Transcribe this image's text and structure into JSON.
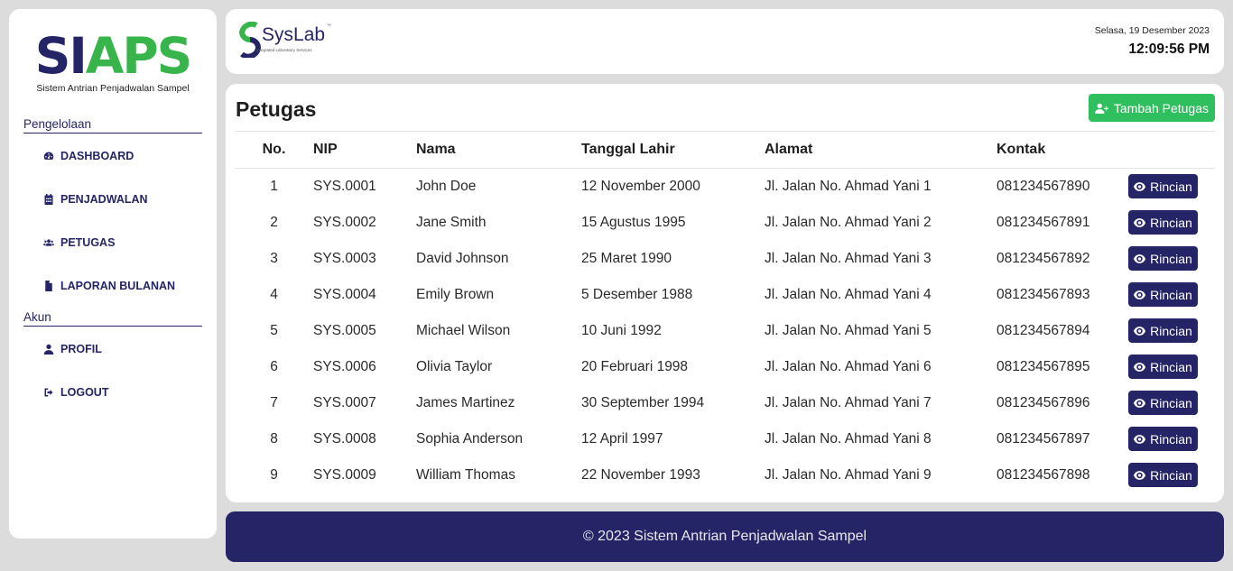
{
  "sidebar": {
    "logo_part1": "SI",
    "logo_part2": "APS",
    "logo_subtitle": "Sistem Antrian Penjadwalan Sampel",
    "sections": [
      {
        "title": "Pengelolaan"
      },
      {
        "title": "Akun"
      }
    ],
    "items": [
      {
        "label": "DASHBOARD",
        "icon": "gauge-icon"
      },
      {
        "label": "PENJADWALAN",
        "icon": "calendar-icon"
      },
      {
        "label": "PETUGAS",
        "icon": "users-icon"
      },
      {
        "label": "LAPORAN BULANAN",
        "icon": "file-icon"
      },
      {
        "label": "PROFIL",
        "icon": "user-icon"
      },
      {
        "label": "LOGOUT",
        "icon": "logout-icon"
      }
    ]
  },
  "header": {
    "brand_sys": "Sys",
    "brand_lab": "Lab",
    "brand_tm": "™",
    "brand_tagline": "Integrated Laboratory Services",
    "date": "Selasa, 19 Desember 2023",
    "time": "12:09:56 PM"
  },
  "main": {
    "title": "Petugas",
    "add_button": "Tambah Petugas",
    "columns": [
      "No.",
      "NIP",
      "Nama",
      "Tanggal Lahir",
      "Alamat",
      "Kontak"
    ],
    "action_label": "Rincian",
    "rows": [
      {
        "no": "1",
        "nip": "SYS.0001",
        "nama": "John Doe",
        "tgl": "12 November 2000",
        "alamat": "Jl. Jalan No. Ahmad Yani 1",
        "kontak": "081234567890"
      },
      {
        "no": "2",
        "nip": "SYS.0002",
        "nama": "Jane Smith",
        "tgl": "15 Agustus 1995",
        "alamat": "Jl. Jalan No. Ahmad Yani 2",
        "kontak": "081234567891"
      },
      {
        "no": "3",
        "nip": "SYS.0003",
        "nama": "David Johnson",
        "tgl": "25 Maret 1990",
        "alamat": "Jl. Jalan No. Ahmad Yani 3",
        "kontak": "081234567892"
      },
      {
        "no": "4",
        "nip": "SYS.0004",
        "nama": "Emily Brown",
        "tgl": "5 Desember 1988",
        "alamat": "Jl. Jalan No. Ahmad Yani 4",
        "kontak": "081234567893"
      },
      {
        "no": "5",
        "nip": "SYS.0005",
        "nama": "Michael Wilson",
        "tgl": "10 Juni 1992",
        "alamat": "Jl. Jalan No. Ahmad Yani 5",
        "kontak": "081234567894"
      },
      {
        "no": "6",
        "nip": "SYS.0006",
        "nama": "Olivia Taylor",
        "tgl": "20 Februari 1998",
        "alamat": "Jl. Jalan No. Ahmad Yani 6",
        "kontak": "081234567895"
      },
      {
        "no": "7",
        "nip": "SYS.0007",
        "nama": "James Martinez",
        "tgl": "30 September 1994",
        "alamat": "Jl. Jalan No. Ahmad Yani 7",
        "kontak": "081234567896"
      },
      {
        "no": "8",
        "nip": "SYS.0008",
        "nama": "Sophia Anderson",
        "tgl": "12 April 1997",
        "alamat": "Jl. Jalan No. Ahmad Yani 8",
        "kontak": "081234567897"
      },
      {
        "no": "9",
        "nip": "SYS.0009",
        "nama": "William Thomas",
        "tgl": "22 November 1993",
        "alamat": "Jl. Jalan No. Ahmad Yani 9",
        "kontak": "081234567898"
      }
    ]
  },
  "footer": {
    "text": "© 2023 Sistem Antrian Penjadwalan Sampel"
  },
  "colors": {
    "primary": "#252466",
    "accent_green": "#38b54a",
    "button_green": "#2fbf5f",
    "background": "#dcdcdc"
  }
}
